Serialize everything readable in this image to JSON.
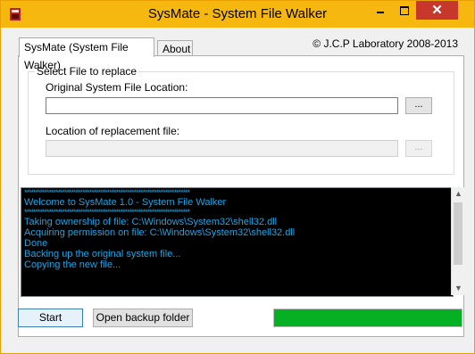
{
  "window": {
    "title": "SysMate - System File Walker",
    "close_glyph": "✕",
    "accent_color": "#f6b70f",
    "close_color": "#c7372c"
  },
  "tabs": [
    {
      "label": "SysMate (System File Walker)",
      "selected": true
    },
    {
      "label": "About",
      "selected": false
    }
  ],
  "copyright": "© J.C.P Laboratory 2008-2013",
  "group": {
    "title": "Select File to replace",
    "original_label": "Original System File Location:",
    "original_value": "",
    "original_browse": "...",
    "replacement_label": "Location of replacement file:",
    "replacement_value": "",
    "replacement_browse": "..."
  },
  "log": {
    "text_color": "#1ea4e6",
    "lines": [
      "**************************************************************************",
      "Welcome to SysMate 1.0 - System File Walker",
      "**************************************************************************",
      "",
      "Taking ownership of file: C:\\Windows\\System32\\shell32.dll",
      "Acquiring permission on file: C:\\Windows\\System32\\shell32.dll",
      "Done",
      "Backing up the original system file...",
      "Copying the new file..."
    ]
  },
  "buttons": {
    "start": "Start",
    "open_backup": "Open backup folder"
  },
  "progress": {
    "value": 1.0,
    "color": "#06b025"
  }
}
